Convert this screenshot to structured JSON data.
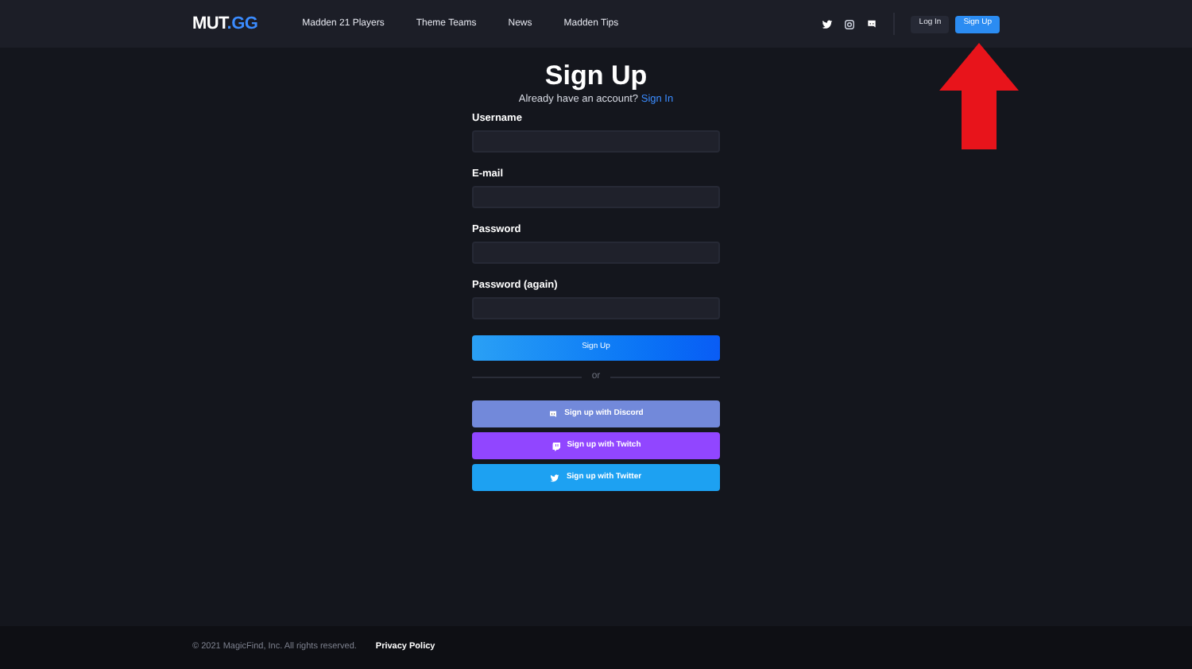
{
  "header": {
    "logo": {
      "text": "MUT",
      "accent": ".GG"
    },
    "nav": [
      "Madden 21 Players",
      "Theme Teams",
      "News",
      "Madden Tips"
    ],
    "social": [
      {
        "kind": "twitter"
      },
      {
        "kind": "instagram"
      },
      {
        "kind": "discord"
      }
    ],
    "login": "Log In",
    "signup": "Sign Up"
  },
  "form": {
    "title": "Sign Up",
    "prompt": "Already have an account?",
    "prompt_link": "Sign In",
    "fields": [
      {
        "label": "Username"
      },
      {
        "label": "E-mail"
      },
      {
        "label": "Password"
      },
      {
        "label": "Password (again)"
      }
    ],
    "submit": "Sign Up",
    "divider": "or",
    "social_buttons": [
      {
        "kind": "discord",
        "label": "Sign up with Discord"
      },
      {
        "kind": "twitch",
        "label": "Sign up with Twitch"
      },
      {
        "kind": "twitter",
        "label": "Sign up with Twitter"
      }
    ]
  },
  "footer": {
    "copyright": "© 2021 MagicFind, Inc. All rights reserved.",
    "link": "Privacy Policy"
  }
}
